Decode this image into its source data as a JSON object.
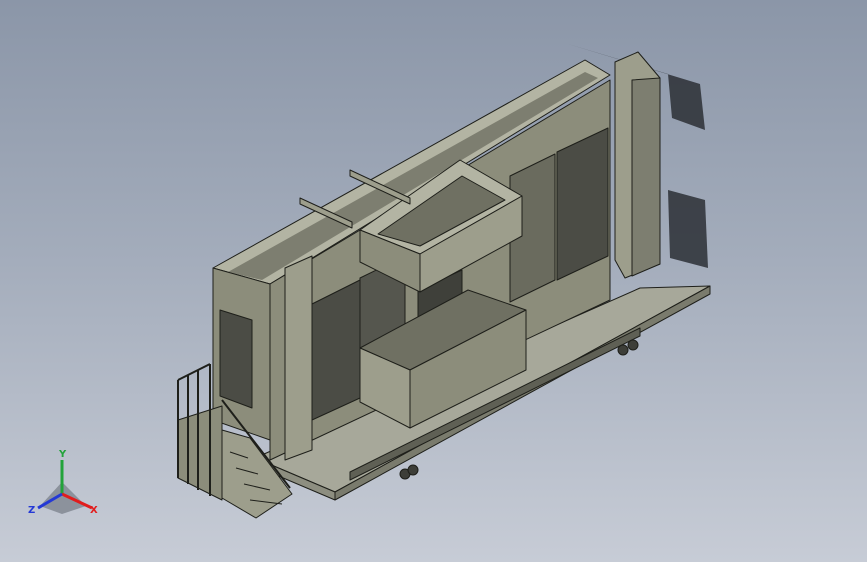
{
  "viewport": {
    "background_top": "#8b96a8",
    "background_bottom": "#c7ccd6"
  },
  "model": {
    "description_icon": "tiny-house-trailer-model",
    "colors": {
      "wall_face": "#8c8d7b",
      "wall_side": "#6f7062",
      "wall_top": "#b3b4a3",
      "edge": "#1e1f1a",
      "window": "#4b4c45",
      "deck": "#a7a89a",
      "shadow": "#2c2f35"
    }
  },
  "triad": {
    "x_label": "X",
    "y_label": "Y",
    "z_label": "Z",
    "x_color": "#e11d1d",
    "y_color": "#22a33a",
    "z_color": "#2439d6"
  }
}
